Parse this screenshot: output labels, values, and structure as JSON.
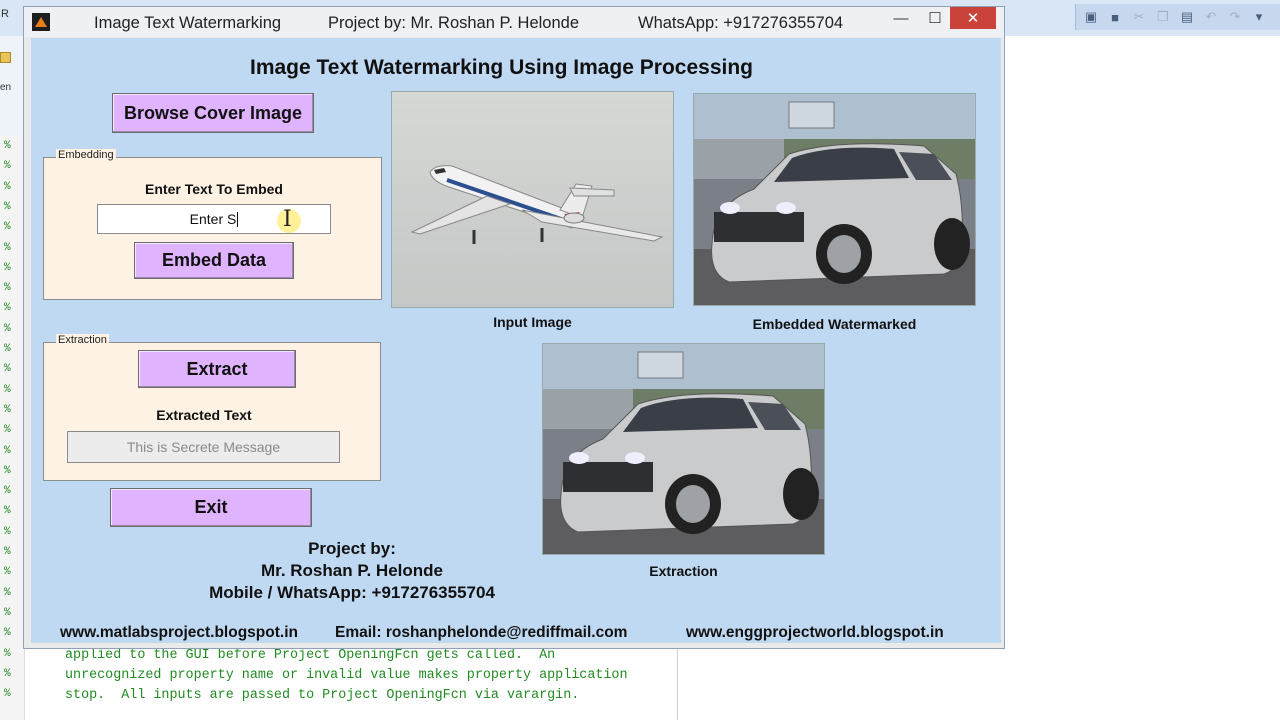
{
  "window": {
    "app_name": "Image Text Watermarking",
    "project_by": "Project by: Mr. Roshan P. Helonde",
    "whatsapp": "WhatsApp: +917276355704"
  },
  "gui": {
    "heading": "Image Text Watermarking Using Image Processing",
    "browse_label": "Browse Cover Image",
    "embedding": {
      "panel_title": "Embedding",
      "prompt": "Enter Text To Embed",
      "input_value": "Enter S",
      "embed_label": "Embed Data"
    },
    "extraction": {
      "panel_title": "Extraction",
      "extract_label": "Extract",
      "result_label": "Extracted Text",
      "result_value": "This is Secrete Message"
    },
    "exit_label": "Exit",
    "captions": {
      "input": "Input Image",
      "embedded": "Embedded Watermarked",
      "extraction": "Extraction"
    },
    "credits": {
      "line1": "Project by:",
      "line2": "Mr. Roshan P. Helonde",
      "line3": "Mobile / WhatsApp: +917276355704"
    },
    "footer": {
      "site1": "www.matlabsproject.blogspot.in",
      "email": "Email: roshanphelonde@rediffmail.com",
      "site2": "www.enggprojectworld.blogspot.in"
    }
  },
  "editor": {
    "corner_text": "R",
    "side_text": "en",
    "comment_lines": [
      "applied to the GUI before Project OpeningFcn gets called.  An",
      "unrecognized property name or invalid value makes property application",
      "stop.  All inputs are passed to Project OpeningFcn via varargin."
    ],
    "gutter_mark": "%"
  },
  "colors": {
    "figure_bg": "#c0d9f2",
    "button_bg": "#e0b3ff",
    "panel_bg": "#fdf2e4",
    "close_red": "#c9433a",
    "comment_green": "#228b22"
  }
}
